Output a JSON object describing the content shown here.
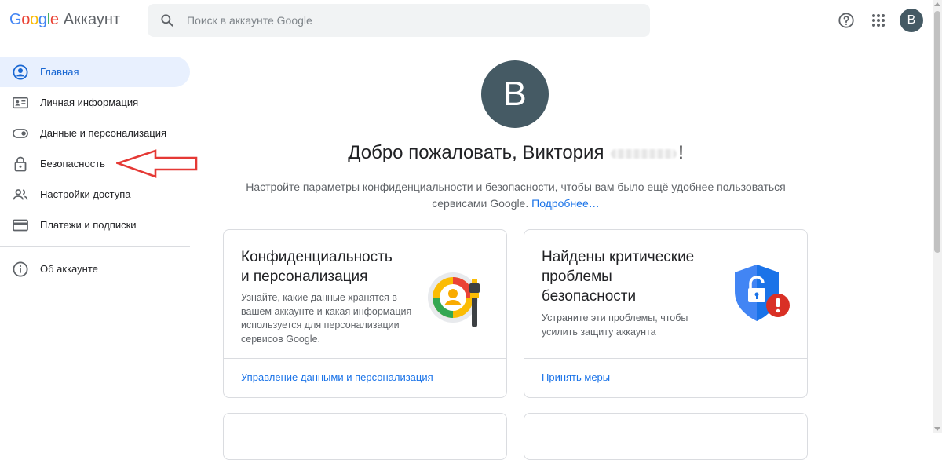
{
  "header": {
    "logo_text": "Google",
    "product_name": "Аккаунт",
    "search_placeholder": "Поиск в аккаунте Google",
    "avatar_letter": "B"
  },
  "sidebar": {
    "items": [
      {
        "label": "Главная",
        "icon": "person-circle-icon",
        "active": true
      },
      {
        "label": "Личная информация",
        "icon": "id-card-icon"
      },
      {
        "label": "Данные и персонализация",
        "icon": "toggle-icon"
      },
      {
        "label": "Безопасность",
        "icon": "lock-icon"
      },
      {
        "label": "Настройки доступа",
        "icon": "people-icon"
      },
      {
        "label": "Платежи и подписки",
        "icon": "credit-card-icon"
      }
    ],
    "about": {
      "label": "Об аккаунте",
      "icon": "info-icon"
    }
  },
  "main": {
    "avatar_letter": "B",
    "welcome_prefix": "Добро пожаловать, Виктория",
    "welcome_suffix": "!",
    "subtitle": "Настройте параметры конфиденциальности и безопасности, чтобы вам было ещё удобнее пользоваться сервисами Google.",
    "more_link": "Подробнее…"
  },
  "cards": [
    {
      "title_line1": "Конфиденциальность",
      "title_line2": "и персонализация",
      "desc": "Узнайте, какие данные хранятся в вашем аккаунте и какая информация используется для персонализации сервисов Google.",
      "link": "Управление данными и персонализация"
    },
    {
      "title_line1": "Найдены критические",
      "title_line2": "проблемы",
      "title_line3": "безопасности",
      "desc": "Устраните эти проблемы, чтобы усилить защиту аккаунта",
      "link": "Принять меры"
    }
  ],
  "colors": {
    "accent": "#1a73e8",
    "active_bg": "#e8f0fe",
    "avatar_bg": "#455a64",
    "arrow": "#e53935"
  }
}
